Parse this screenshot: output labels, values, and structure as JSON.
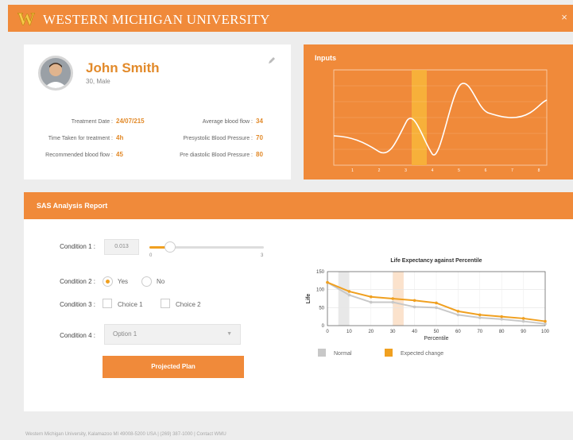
{
  "header": {
    "brand": "Western Michigan University",
    "brand_display": "WESTERN MICHIGAN UNIVERSITY",
    "logo": "W",
    "close_icon": "×"
  },
  "profile": {
    "name": "John Smith",
    "subtitle": "30, Male",
    "fields": [
      {
        "label": "Treatment Date :",
        "value": "24/07/215"
      },
      {
        "label": "Time Taken for treatment :",
        "value": "4h"
      },
      {
        "label": "Recommended blood flow :",
        "value": "45"
      },
      {
        "label": "Average blood flow :",
        "value": "34"
      },
      {
        "label": "Presystolic Blood Pressure :",
        "value": "70"
      },
      {
        "label": "Pre diastolic Blood Pressure :",
        "value": "80"
      }
    ]
  },
  "inputs": {
    "title": "Inputs",
    "x_ticks": [
      "1",
      "2",
      "3",
      "4",
      "5",
      "6",
      "7",
      "8"
    ]
  },
  "report": {
    "title": "SAS Analysis Report",
    "condition1": {
      "label": "Condition 1 :",
      "value": "0.013",
      "slider_fraction": 0.18,
      "min_label": "0",
      "max_label": "3"
    },
    "condition2": {
      "label": "Condition 2 :",
      "options": [
        "Yes",
        "No"
      ],
      "selected": "Yes"
    },
    "condition3": {
      "label": "Condition 3 :",
      "options": [
        "Choice 1",
        "Choice 2"
      ]
    },
    "condition4": {
      "label": "Condition 4 :",
      "selected": "Option 1"
    },
    "button": "Projected Plan"
  },
  "chart_data": {
    "type": "line",
    "title": "Life Expectancy against Percentile",
    "xlabel": "Percentile",
    "ylabel": "Life",
    "xlim": [
      0,
      100
    ],
    "ylim": [
      0,
      150
    ],
    "x_ticks": [
      0,
      10,
      20,
      30,
      40,
      50,
      60,
      70,
      80,
      90,
      100
    ],
    "y_ticks": [
      0,
      50,
      100,
      150
    ],
    "series": [
      {
        "name": "Normal",
        "color": "#c8c8c8",
        "x": [
          0,
          10,
          20,
          30,
          40,
          50,
          60,
          70,
          80,
          90,
          100
        ],
        "y": [
          120,
          85,
          65,
          65,
          52,
          50,
          30,
          22,
          18,
          12,
          5
        ]
      },
      {
        "name": "Expected change",
        "color": "#f0a020",
        "x": [
          0,
          10,
          20,
          30,
          40,
          50,
          60,
          70,
          80,
          90,
          100
        ],
        "y": [
          120,
          95,
          80,
          75,
          70,
          63,
          40,
          30,
          25,
          20,
          12
        ]
      }
    ],
    "legend_position": "bottom"
  },
  "footer": "Western Michigan University, Kalamazoo MI 49008-5200 USA | (269) 387-1000 | Contact WMU"
}
